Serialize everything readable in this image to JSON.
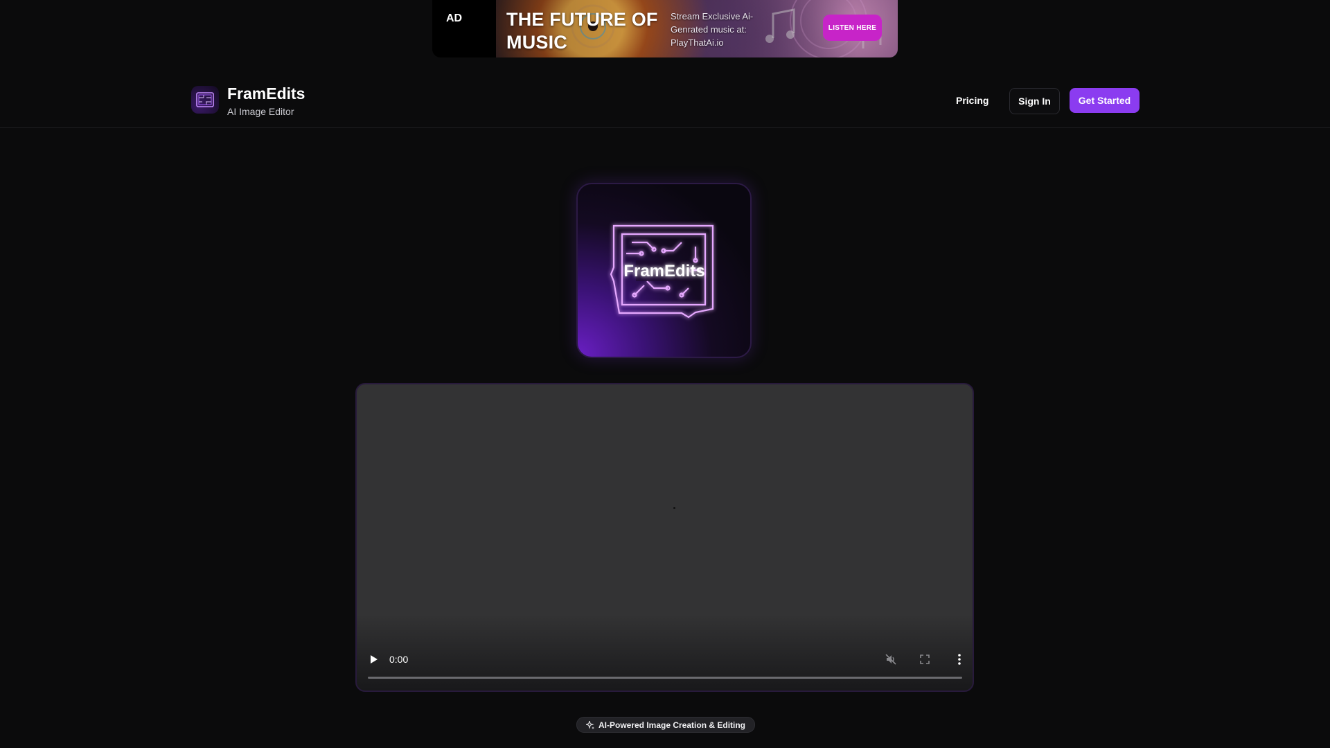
{
  "ad": {
    "tag": "AD",
    "headline": "THE FUTURE OF MUSIC",
    "subtext": "Stream Exclusive Ai-Genrated music at: PlayThatAi.io",
    "cta_label": "LISTEN HERE",
    "cta_color": "#c724c8"
  },
  "header": {
    "brand_name": "FramEdits",
    "brand_tagline": "AI Image Editor",
    "nav": {
      "pricing": "Pricing",
      "sign_in": "Sign In",
      "get_started": "Get Started"
    },
    "accent_color": "#8b3cf0"
  },
  "hero": {
    "logo_text": "FramEdits"
  },
  "video": {
    "current_time": "0:00",
    "progress": 0,
    "muted": true,
    "icons": [
      "play-icon",
      "muted-icon",
      "fullscreen-icon",
      "more-vertical-icon"
    ]
  },
  "badge": {
    "icon": "sparkles-icon",
    "label": "AI-Powered Image Creation & Editing"
  }
}
